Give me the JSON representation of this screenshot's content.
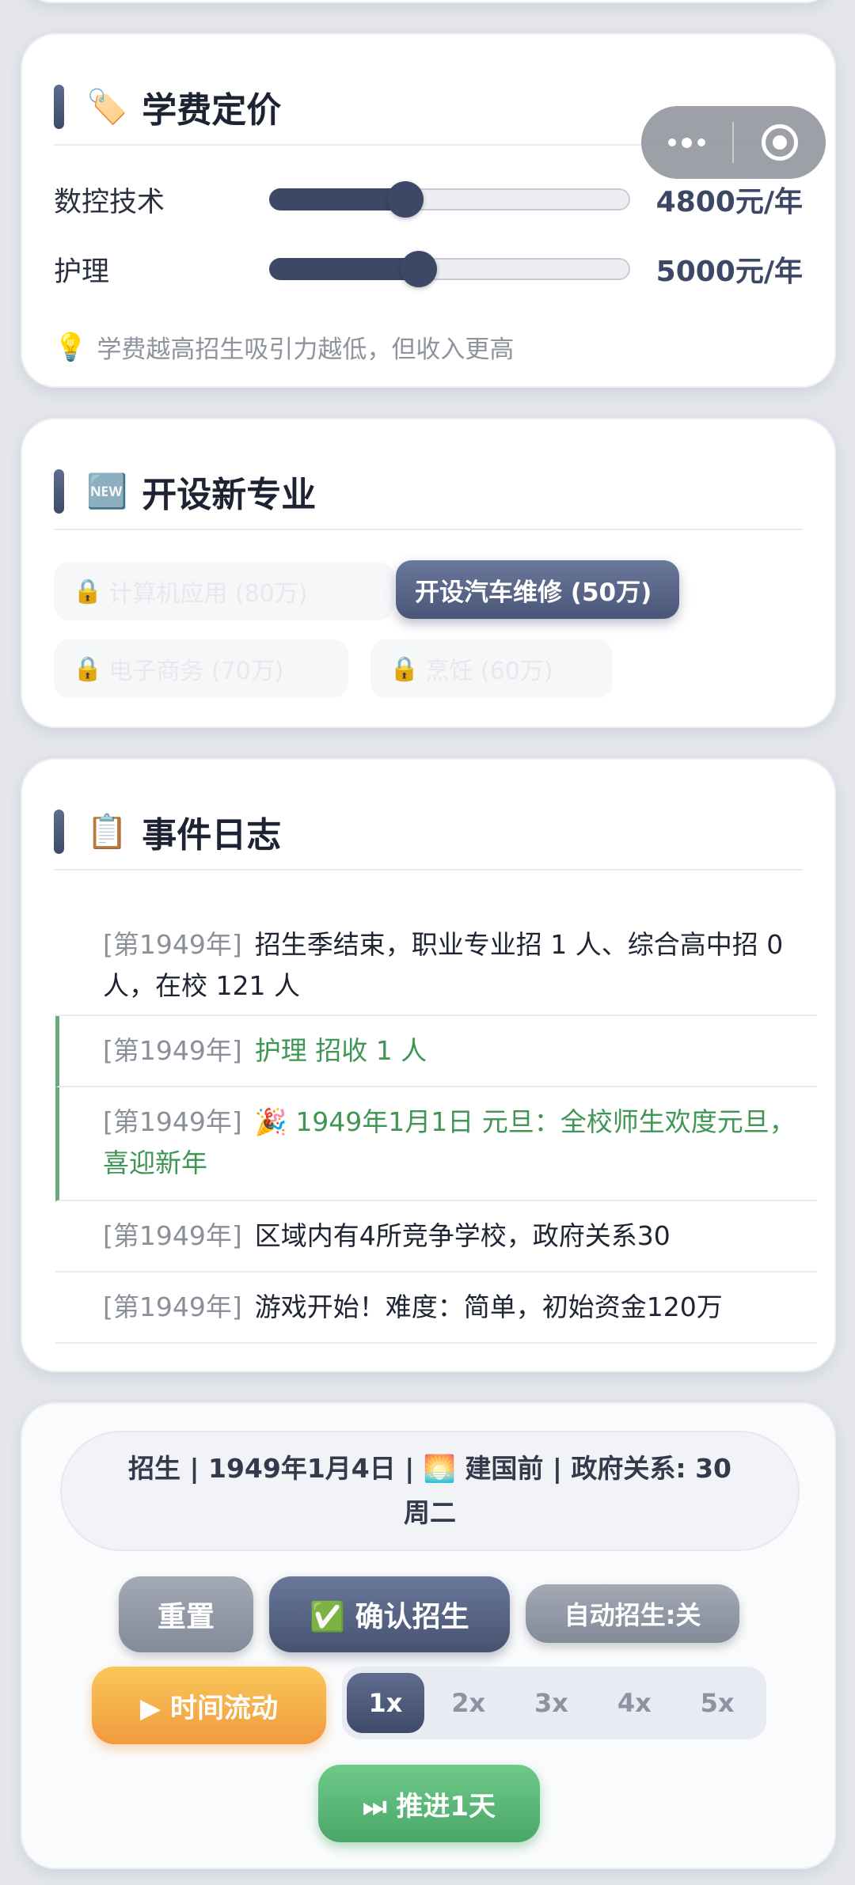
{
  "pricing": {
    "emoji": "🏷️",
    "title": "学费定价",
    "rows": [
      {
        "name": "数控技术",
        "value_label": "4800元/年",
        "slider_fraction": 0.375
      },
      {
        "name": "护理",
        "value_label": "5000元/年",
        "slider_fraction": 0.413
      }
    ],
    "hint_icon": "💡",
    "hint": "学费越高招生吸引力越低，但收入更高"
  },
  "capsule": {
    "menu_icon": "more-dots-icon",
    "close_icon": "target-circle-icon"
  },
  "new_major": {
    "emoji": "🆕",
    "title": "开设新专业",
    "lock_icon": "🔒",
    "locked": [
      "计算机应用 (80万)",
      "电子商务 (70万)",
      "烹饪 (60万)"
    ],
    "active_label": "开设汽车维修 (50万)"
  },
  "event_log": {
    "emoji": "📋",
    "title": "事件日志",
    "items": [
      {
        "year": "[第1949年]",
        "msg": "招生季结束，职业专业招 1 人、综合高中招 0 人，在校 121 人"
      },
      {
        "year": "[第1949年]",
        "msg": "护理 招收 1 人"
      },
      {
        "year": "[第1949年]",
        "msg": "🎉 1949年1月1日 元旦：全校师生欢度元旦，喜迎新年"
      },
      {
        "year": "[第1949年]",
        "msg": "区域内有4所竞争学校，政府关系30"
      },
      {
        "year": "[第1949年]",
        "msg": "游戏开始！难度：简单，初始资金120万"
      }
    ]
  },
  "status": {
    "line1": "招生 | 1949年1月4日 | 🌅 建国前 | 政府关系: 30",
    "line2": "周二"
  },
  "controls": {
    "reset": "重置",
    "confirm": "✅ 确认招生",
    "auto": "自动招生:关",
    "time_flow": "▶ 时间流动",
    "speeds": [
      "1x",
      "2x",
      "3x",
      "4x",
      "5x"
    ],
    "active_speed": "1x",
    "advance": "⏭ 推进1天"
  },
  "colors": {
    "accent": "#3c4865",
    "green": "#3f9654",
    "orange": "#f19a3d",
    "page_bg": "#e4e6ec"
  }
}
